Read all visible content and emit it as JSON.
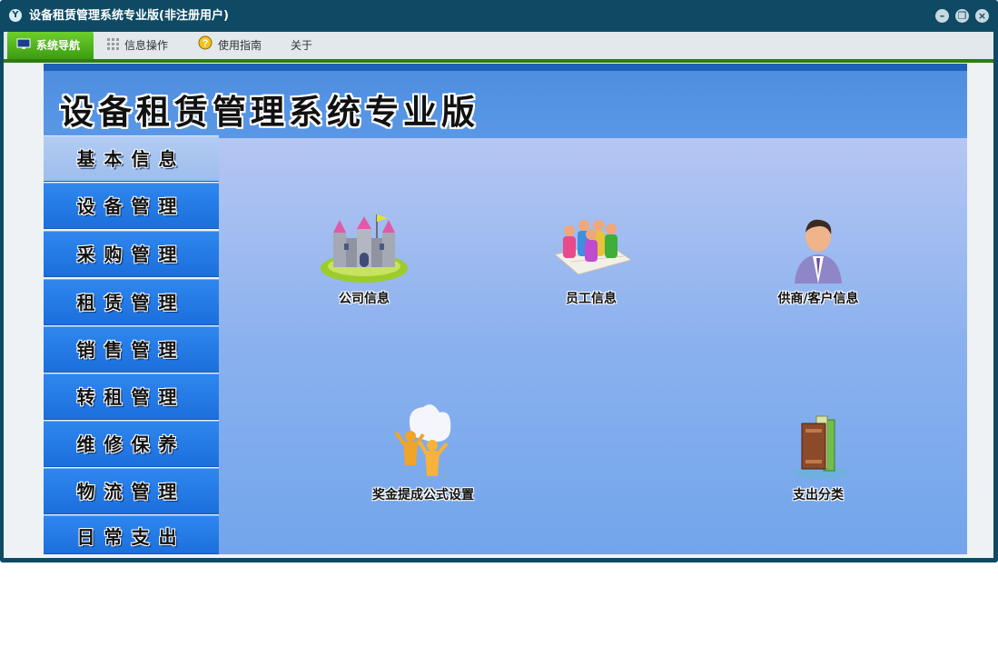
{
  "window": {
    "title": "设备租赁管理系统专业版(非注册用户)",
    "icon": "app-logo-icon",
    "controls": [
      "minimize-icon",
      "restore-icon",
      "close-icon"
    ]
  },
  "menubar": {
    "items": [
      {
        "label": "系统导航",
        "icon": "monitor-icon",
        "active": true
      },
      {
        "label": "信息操作",
        "icon": "grid-icon",
        "active": false
      },
      {
        "label": "使用指南",
        "icon": "help-icon",
        "active": false
      },
      {
        "label": "关于",
        "icon": "",
        "active": false
      }
    ]
  },
  "header": {
    "title": "设备租赁管理系统专业版"
  },
  "sidebar": {
    "items": [
      {
        "label": "基本信息",
        "active": true
      },
      {
        "label": "设备管理"
      },
      {
        "label": "采购管理"
      },
      {
        "label": "租赁管理"
      },
      {
        "label": "销售管理"
      },
      {
        "label": "转租管理"
      },
      {
        "label": "维修保养"
      },
      {
        "label": "物流管理"
      },
      {
        "label": "日常支出"
      }
    ]
  },
  "content": {
    "tiles": [
      {
        "label": "公司信息",
        "icon": "castle-icon"
      },
      {
        "label": "员工信息",
        "icon": "staff-group-icon"
      },
      {
        "label": "供商/客户信息",
        "icon": "business-person-icon"
      },
      {
        "label": "奖金提成公式设置",
        "icon": "award-people-icon"
      },
      {
        "label": "支出分类",
        "icon": "books-icon"
      }
    ]
  },
  "colors": {
    "frame": "#0e4a63",
    "menu_active": "#4cb11d",
    "header_band": "#5592e3",
    "sidebar_item": "#2a80ea",
    "sidebar_active": "#a8c5f0"
  }
}
